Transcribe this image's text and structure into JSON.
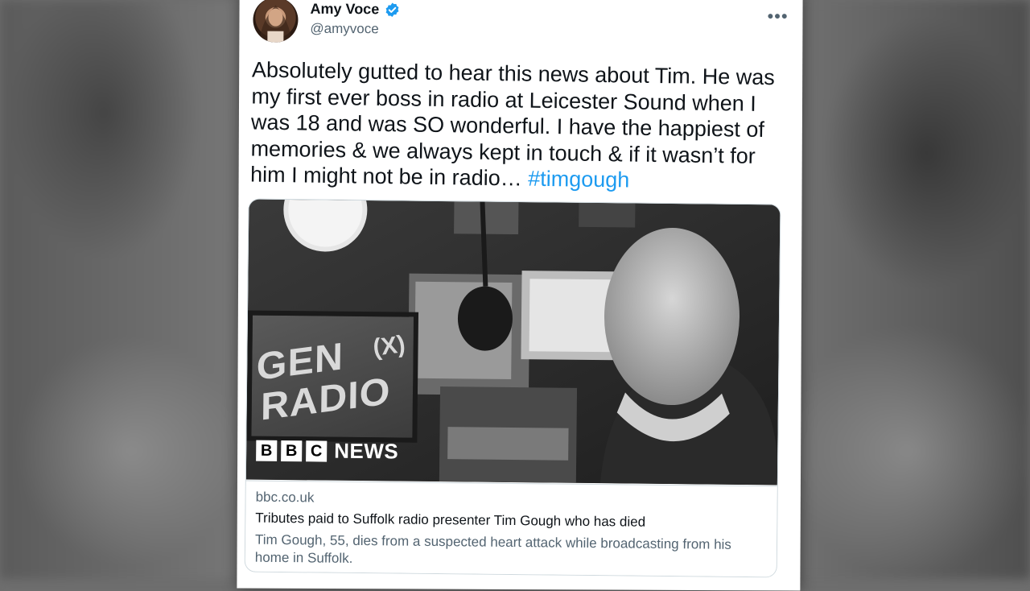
{
  "tweet": {
    "author_name": "Amy Voce",
    "author_handle": "@amyvoce",
    "more_label": "•••",
    "text_lines": [
      "Absolutely gutted to hear this news about Tim. He was",
      "my first ever boss in radio at Leicester Sound when I",
      "was 18 and was SO wonderful. I have the happiest of",
      "memories & we always kept in touch & if it wasn’t for",
      "him I might not be in radio… "
    ],
    "hashtag": "#timgough"
  },
  "link_card": {
    "domain": "bbc.co.uk",
    "title": "Tributes paid to Suffolk radio presenter Tim Gough who has died",
    "description": "Tim Gough, 55, dies from a suspected heart attack while broadcasting from his home in Suffolk.",
    "image_overlay": {
      "logo_letters": [
        "B",
        "B",
        "C"
      ],
      "logo_word": "NEWS",
      "studio_sign_line1": "GEN",
      "studio_sign_line2": "RADIO",
      "studio_sign_icon": "(X)"
    }
  },
  "colors": {
    "hashtag": "#1d9bf0",
    "verified": "#1d9bf0",
    "secondary_text": "#536471",
    "primary_text": "#0f1419",
    "card_border": "#cfd9de"
  },
  "icons": [
    "verified-badge-icon",
    "more-options-icon",
    "bbc-news-logo"
  ]
}
